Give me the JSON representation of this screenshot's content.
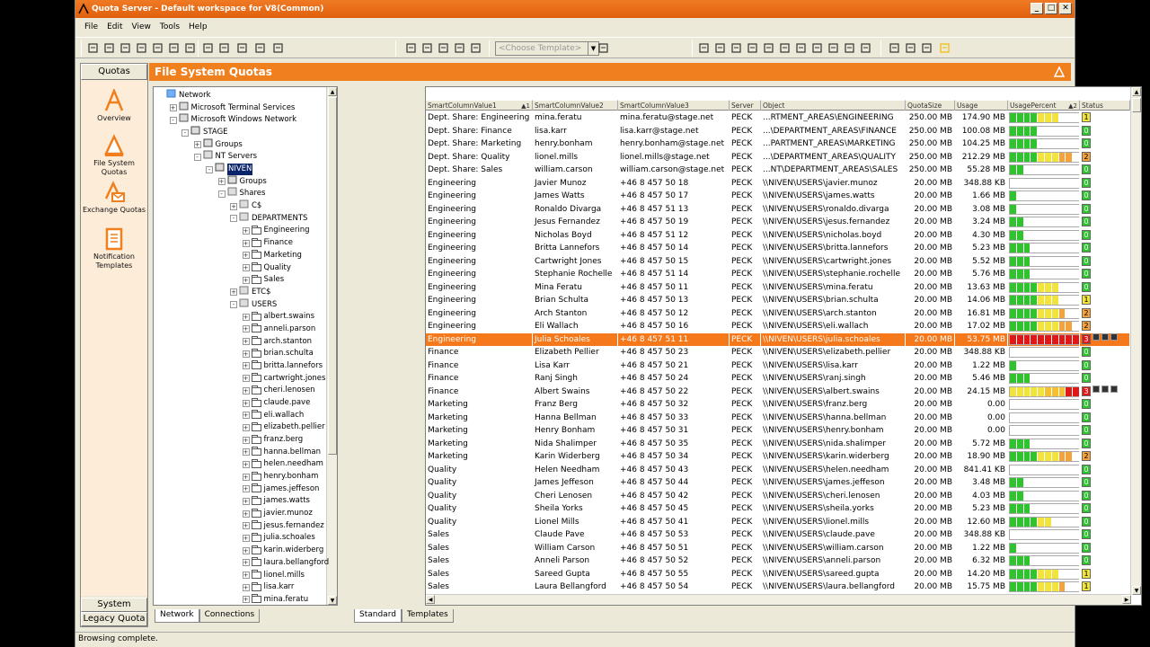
{
  "window": {
    "title": "Quota Server - Default workspace for V8(Common)"
  },
  "menu": [
    "File",
    "Edit",
    "View",
    "Tools",
    "Help"
  ],
  "toolbar": {
    "template_placeholder": "<Choose Template>"
  },
  "nav": {
    "header": "Quotas",
    "items": [
      {
        "label": "Overview",
        "icon": "overview-icon"
      },
      {
        "label": "File System Quotas",
        "icon": "file-system-quotas-icon"
      },
      {
        "label": "Exchange Quotas",
        "icon": "exchange-quotas-icon"
      },
      {
        "label": "Notification Templates",
        "icon": "notification-templates-icon"
      }
    ],
    "footer": [
      "System",
      "Legacy Quota"
    ]
  },
  "main": {
    "title": "File System Quotas"
  },
  "tree": {
    "nodes": [
      {
        "l": "Network",
        "d": 0,
        "i": "network"
      },
      {
        "l": "Microsoft Terminal Services",
        "d": 1,
        "i": "net",
        "e": "+"
      },
      {
        "l": "Microsoft Windows Network",
        "d": 1,
        "i": "net",
        "e": "-"
      },
      {
        "l": "STAGE",
        "d": 2,
        "i": "domain",
        "e": "-"
      },
      {
        "l": "Groups",
        "d": 3,
        "i": "group",
        "e": "+"
      },
      {
        "l": "NT Servers",
        "d": 3,
        "i": "server",
        "e": "-"
      },
      {
        "l": "NIVEN",
        "d": 4,
        "i": "pc",
        "e": "-",
        "sel": true
      },
      {
        "l": "Groups",
        "d": 5,
        "i": "group",
        "e": "+"
      },
      {
        "l": "Shares",
        "d": 5,
        "i": "share",
        "e": "-"
      },
      {
        "l": "C$",
        "d": 6,
        "i": "share",
        "e": "+"
      },
      {
        "l": "DEPARTMENTS",
        "d": 6,
        "i": "share",
        "e": "-"
      },
      {
        "l": "Engineering",
        "d": 7,
        "i": "folder",
        "e": "+"
      },
      {
        "l": "Finance",
        "d": 7,
        "i": "folder",
        "e": "+"
      },
      {
        "l": "Marketing",
        "d": 7,
        "i": "folder",
        "e": "+"
      },
      {
        "l": "Quality",
        "d": 7,
        "i": "folder",
        "e": "+"
      },
      {
        "l": "Sales",
        "d": 7,
        "i": "folder",
        "e": "+"
      },
      {
        "l": "ETC$",
        "d": 6,
        "i": "share",
        "e": "+"
      },
      {
        "l": "USERS",
        "d": 6,
        "i": "share",
        "e": "-"
      },
      {
        "l": "albert.swains",
        "d": 7,
        "i": "folder",
        "e": "+"
      },
      {
        "l": "anneli.parson",
        "d": 7,
        "i": "folder",
        "e": "+"
      },
      {
        "l": "arch.stanton",
        "d": 7,
        "i": "folder",
        "e": "+"
      },
      {
        "l": "brian.schulta",
        "d": 7,
        "i": "folder",
        "e": "+"
      },
      {
        "l": "britta.lannefors",
        "d": 7,
        "i": "folder",
        "e": "+"
      },
      {
        "l": "cartwright.jones",
        "d": 7,
        "i": "folder",
        "e": "+"
      },
      {
        "l": "cheri.lenosen",
        "d": 7,
        "i": "folder",
        "e": "+"
      },
      {
        "l": "claude.pave",
        "d": 7,
        "i": "folder",
        "e": "+"
      },
      {
        "l": "eli.wallach",
        "d": 7,
        "i": "folder",
        "e": "+"
      },
      {
        "l": "elizabeth.pellier",
        "d": 7,
        "i": "folder",
        "e": "+"
      },
      {
        "l": "franz.berg",
        "d": 7,
        "i": "folder",
        "e": "+"
      },
      {
        "l": "hanna.bellman",
        "d": 7,
        "i": "folder",
        "e": "+"
      },
      {
        "l": "helen.needham",
        "d": 7,
        "i": "folder",
        "e": "+"
      },
      {
        "l": "henry.bonham",
        "d": 7,
        "i": "folder",
        "e": "+"
      },
      {
        "l": "james.jeffeson",
        "d": 7,
        "i": "folder",
        "e": "+"
      },
      {
        "l": "james.watts",
        "d": 7,
        "i": "folder",
        "e": "+"
      },
      {
        "l": "javier.munoz",
        "d": 7,
        "i": "folder",
        "e": "+"
      },
      {
        "l": "jesus.fernandez",
        "d": 7,
        "i": "folder",
        "e": "+"
      },
      {
        "l": "julia.schoales",
        "d": 7,
        "i": "folder",
        "e": "+"
      },
      {
        "l": "karin.widerberg",
        "d": 7,
        "i": "folder",
        "e": "+"
      },
      {
        "l": "laura.bellangford",
        "d": 7,
        "i": "folder",
        "e": "+"
      },
      {
        "l": "lionel.mills",
        "d": 7,
        "i": "folder",
        "e": "+"
      },
      {
        "l": "lisa.karr",
        "d": 7,
        "i": "folder",
        "e": "+"
      },
      {
        "l": "mina.feratu",
        "d": 7,
        "i": "folder",
        "e": "+"
      }
    ]
  },
  "tree_tabs": [
    "Network",
    "Connections"
  ],
  "grid_tabs": [
    "Standard",
    "Templates"
  ],
  "columns": [
    "SmartColumnValue1",
    "SmartColumnValue2",
    "SmartColumnValue3",
    "Server",
    "Object",
    "QuotaSize",
    "Usage",
    "UsagePercent",
    "Status"
  ],
  "sort_markers": {
    "c1": "1",
    "c8": "2"
  },
  "rows": [
    [
      "Dept. Share: Engineering",
      "mina.feratu",
      "mina.feratu@stage.net",
      "PECK",
      "...RTMENT_AREAS\\ENGINEERING",
      "250.00 MB",
      "174.90 MB",
      0.7,
      "1"
    ],
    [
      "Dept. Share: Finance",
      "lisa.karr",
      "lisa.karr@stage.net",
      "PECK",
      "...\\DEPARTMENT_AREAS\\FINANCE",
      "250.00 MB",
      "100.08 MB",
      0.4,
      "0"
    ],
    [
      "Dept. Share: Marketing",
      "henry.bonham",
      "henry.bonham@stage.net",
      "PECK",
      "...PARTMENT_AREAS\\MARKETING",
      "250.00 MB",
      "104.25 MB",
      0.42,
      "0"
    ],
    [
      "Dept. Share: Quality",
      "lionel.mills",
      "lionel.mills@stage.net",
      "PECK",
      "...\\DEPARTMENT_AREAS\\QUALITY",
      "250.00 MB",
      "212.29 MB",
      0.85,
      "2"
    ],
    [
      "Dept. Share: Sales",
      "william.carson",
      "william.carson@stage.net",
      "PECK",
      "...NT\\DEPARTMENT_AREAS\\SALES",
      "250.00 MB",
      "55.28 MB",
      0.22,
      "0"
    ],
    [
      "Engineering",
      "Javier Munoz",
      "+46 8 457 50 18",
      "PECK",
      "\\\\NIVEN\\USERS\\javier.munoz",
      "20.00 MB",
      "348.88 KB",
      0.02,
      "0"
    ],
    [
      "Engineering",
      "James Watts",
      "+46 8 457 50 17",
      "PECK",
      "\\\\NIVEN\\USERS\\james.watts",
      "20.00 MB",
      "1.66 MB",
      0.08,
      "0"
    ],
    [
      "Engineering",
      "Ronaldo Divarga",
      "+46 8 457 51 13",
      "PECK",
      "\\\\NIVEN\\USERS\\ronaldo.divarga",
      "20.00 MB",
      "3.08 MB",
      0.15,
      "0"
    ],
    [
      "Engineering",
      "Jesus Fernandez",
      "+46 8 457 50 19",
      "PECK",
      "\\\\NIVEN\\USERS\\jesus.fernandez",
      "20.00 MB",
      "3.24 MB",
      0.16,
      "0"
    ],
    [
      "Engineering",
      "Nicholas Boyd",
      "+46 8 457 51 12",
      "PECK",
      "\\\\NIVEN\\USERS\\nicholas.boyd",
      "20.00 MB",
      "4.30 MB",
      0.21,
      "0"
    ],
    [
      "Engineering",
      "Britta Lannefors",
      "+46 8 457 50 14",
      "PECK",
      "\\\\NIVEN\\USERS\\britta.lannefors",
      "20.00 MB",
      "5.23 MB",
      0.26,
      "0"
    ],
    [
      "Engineering",
      "Cartwright Jones",
      "+46 8 457 50 15",
      "PECK",
      "\\\\NIVEN\\USERS\\cartwright.jones",
      "20.00 MB",
      "5.52 MB",
      0.27,
      "0"
    ],
    [
      "Engineering",
      "Stephanie Rochelle",
      "+46 8 457 51 14",
      "PECK",
      "\\\\NIVEN\\USERS\\stephanie.rochelle",
      "20.00 MB",
      "5.76 MB",
      0.28,
      "0"
    ],
    [
      "Engineering",
      "Mina Feratu",
      "+46 8 457 50 11",
      "PECK",
      "\\\\NIVEN\\USERS\\mina.feratu",
      "20.00 MB",
      "13.63 MB",
      0.68,
      "0"
    ],
    [
      "Engineering",
      "Brian Schulta",
      "+46 8 457 50 13",
      "PECK",
      "\\\\NIVEN\\USERS\\brian.schulta",
      "20.00 MB",
      "14.06 MB",
      0.7,
      "1"
    ],
    [
      "Engineering",
      "Arch Stanton",
      "+46 8 457 50 12",
      "PECK",
      "\\\\NIVEN\\USERS\\arch.stanton",
      "20.00 MB",
      "16.81 MB",
      0.84,
      "2"
    ],
    [
      "Engineering",
      "Eli Wallach",
      "+46 8 457 50 16",
      "PECK",
      "\\\\NIVEN\\USERS\\eli.wallach",
      "20.00 MB",
      "17.02 MB",
      0.85,
      "2"
    ],
    [
      "Engineering",
      "Julia Schoales",
      "+46 8 457 51 11",
      "PECK",
      "\\\\NIVEN\\USERS\\julia.schoales",
      "20.00 MB",
      "53.75 MB",
      1.0,
      "3"
    ],
    [
      "Finance",
      "Elizabeth Pellier",
      "+46 8 457 50 23",
      "PECK",
      "\\\\NIVEN\\USERS\\elizabeth.pellier",
      "20.00 MB",
      "348.88 KB",
      0.02,
      "0"
    ],
    [
      "Finance",
      "Lisa Karr",
      "+46 8 457 50 21",
      "PECK",
      "\\\\NIVEN\\USERS\\lisa.karr",
      "20.00 MB",
      "1.22 MB",
      0.06,
      "0"
    ],
    [
      "Finance",
      "Ranj Singh",
      "+46 8 457 50 24",
      "PECK",
      "\\\\NIVEN\\USERS\\ranj.singh",
      "20.00 MB",
      "5.46 MB",
      0.27,
      "0"
    ],
    [
      "Finance",
      "Albert Swains",
      "+46 8 457 50 22",
      "PECK",
      "\\\\NIVEN\\USERS\\albert.swains",
      "20.00 MB",
      "24.15 MB",
      1.0,
      "3"
    ],
    [
      "Marketing",
      "Franz Berg",
      "+46 8 457 50 32",
      "PECK",
      "\\\\NIVEN\\USERS\\franz.berg",
      "20.00 MB",
      "0.00",
      0,
      "0"
    ],
    [
      "Marketing",
      "Hanna Bellman",
      "+46 8 457 50 33",
      "PECK",
      "\\\\NIVEN\\USERS\\hanna.bellman",
      "20.00 MB",
      "0.00",
      0,
      "0"
    ],
    [
      "Marketing",
      "Henry Bonham",
      "+46 8 457 50 31",
      "PECK",
      "\\\\NIVEN\\USERS\\henry.bonham",
      "20.00 MB",
      "0.00",
      0,
      "0"
    ],
    [
      "Marketing",
      "Nida Shalimper",
      "+46 8 457 50 35",
      "PECK",
      "\\\\NIVEN\\USERS\\nida.shalimper",
      "20.00 MB",
      "5.72 MB",
      0.28,
      "0"
    ],
    [
      "Marketing",
      "Karin Widerberg",
      "+46 8 457 50 34",
      "PECK",
      "\\\\NIVEN\\USERS\\karin.widerberg",
      "20.00 MB",
      "18.90 MB",
      0.94,
      "2"
    ],
    [
      "Quality",
      "Helen Needham",
      "+46 8 457 50 43",
      "PECK",
      "\\\\NIVEN\\USERS\\helen.needham",
      "20.00 MB",
      "841.41 KB",
      0.04,
      "0"
    ],
    [
      "Quality",
      "James Jeffeson",
      "+46 8 457 50 44",
      "PECK",
      "\\\\NIVEN\\USERS\\james.jeffeson",
      "20.00 MB",
      "3.48 MB",
      0.17,
      "0"
    ],
    [
      "Quality",
      "Cheri Lenosen",
      "+46 8 457 50 42",
      "PECK",
      "\\\\NIVEN\\USERS\\cheri.lenosen",
      "20.00 MB",
      "4.03 MB",
      0.2,
      "0"
    ],
    [
      "Quality",
      "Sheila Yorks",
      "+46 8 457 50 45",
      "PECK",
      "\\\\NIVEN\\USERS\\sheila.yorks",
      "20.00 MB",
      "5.23 MB",
      0.26,
      "0"
    ],
    [
      "Quality",
      "Lionel Mills",
      "+46 8 457 50 41",
      "PECK",
      "\\\\NIVEN\\USERS\\lionel.mills",
      "20.00 MB",
      "12.60 MB",
      0.63,
      "0"
    ],
    [
      "Sales",
      "Claude Pave",
      "+46 8 457 50 53",
      "PECK",
      "\\\\NIVEN\\USERS\\claude.pave",
      "20.00 MB",
      "348.88 KB",
      0.02,
      "0"
    ],
    [
      "Sales",
      "William Carson",
      "+46 8 457 50 51",
      "PECK",
      "\\\\NIVEN\\USERS\\william.carson",
      "20.00 MB",
      "1.22 MB",
      0.06,
      "0"
    ],
    [
      "Sales",
      "Anneli Parson",
      "+46 8 457 50 52",
      "PECK",
      "\\\\NIVEN\\USERS\\anneli.parson",
      "20.00 MB",
      "6.32 MB",
      0.31,
      "0"
    ],
    [
      "Sales",
      "Sareed Gupta",
      "+46 8 457 50 55",
      "PECK",
      "\\\\NIVEN\\USERS\\sareed.gupta",
      "20.00 MB",
      "14.20 MB",
      0.71,
      "1"
    ],
    [
      "Sales",
      "Laura Bellangford",
      "+46 8 457 50 54",
      "PECK",
      "\\\\NIVEN\\USERS\\laura.bellangford",
      "20.00 MB",
      "15.75 MB",
      0.79,
      "1"
    ]
  ],
  "highlight_row": 17,
  "colors": {
    "accent": "#f07f1e",
    "green": "#2ec42e",
    "yellow": "#f2e43a",
    "red": "#e01818"
  },
  "status": {
    "text": "Browsing complete."
  }
}
